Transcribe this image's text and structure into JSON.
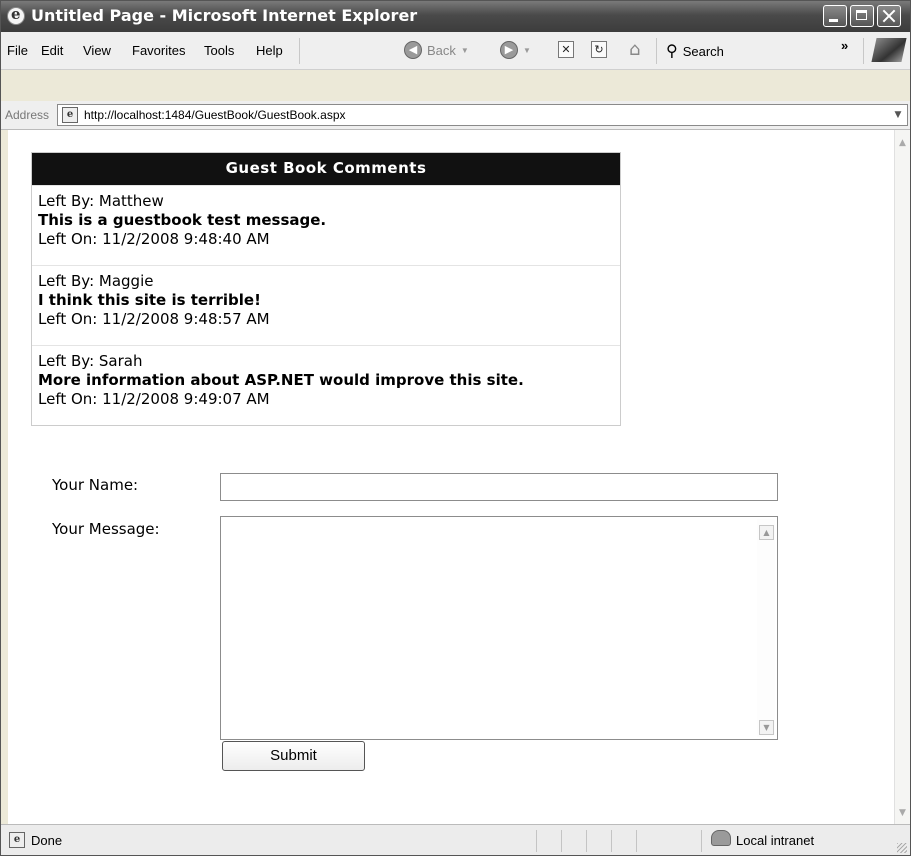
{
  "window": {
    "title": "Untitled Page - Microsoft Internet Explorer"
  },
  "menu": [
    "File",
    "Edit",
    "View",
    "Favorites",
    "Tools",
    "Help"
  ],
  "toolbar": {
    "back_label": "Back",
    "search_label": "Search",
    "more": "»"
  },
  "address": {
    "label": "Address",
    "url": "http://localhost:1484/GuestBook/GuestBook.aspx"
  },
  "guestbook": {
    "header": "Guest Book Comments",
    "entries": [
      {
        "left_by": "Left By: Matthew",
        "message": "This is a guestbook test message.",
        "left_on": "Left On: 11/2/2008 9:48:40 AM"
      },
      {
        "left_by": "Left By: Maggie",
        "message": "I think this site is terrible!",
        "left_on": "Left On: 11/2/2008 9:48:57 AM"
      },
      {
        "left_by": "Left By: Sarah",
        "message": "More information about ASP.NET would improve this site.",
        "left_on": "Left On: 11/2/2008 9:49:07 AM"
      }
    ]
  },
  "form": {
    "name_label": "Your Name:",
    "name_value": "",
    "message_label": "Your Message:",
    "message_value": "",
    "submit_label": "Submit"
  },
  "status": {
    "text": "Done",
    "zone": "Local intranet"
  },
  "icons": {
    "app": "ie-logo-icon",
    "back": "back-arrow-icon",
    "forward": "forward-arrow-icon",
    "stop": "stop-icon",
    "refresh": "refresh-icon",
    "home": "home-icon",
    "search": "magnifier-icon",
    "page": "ie-page-icon",
    "zone": "intranet-icon"
  }
}
